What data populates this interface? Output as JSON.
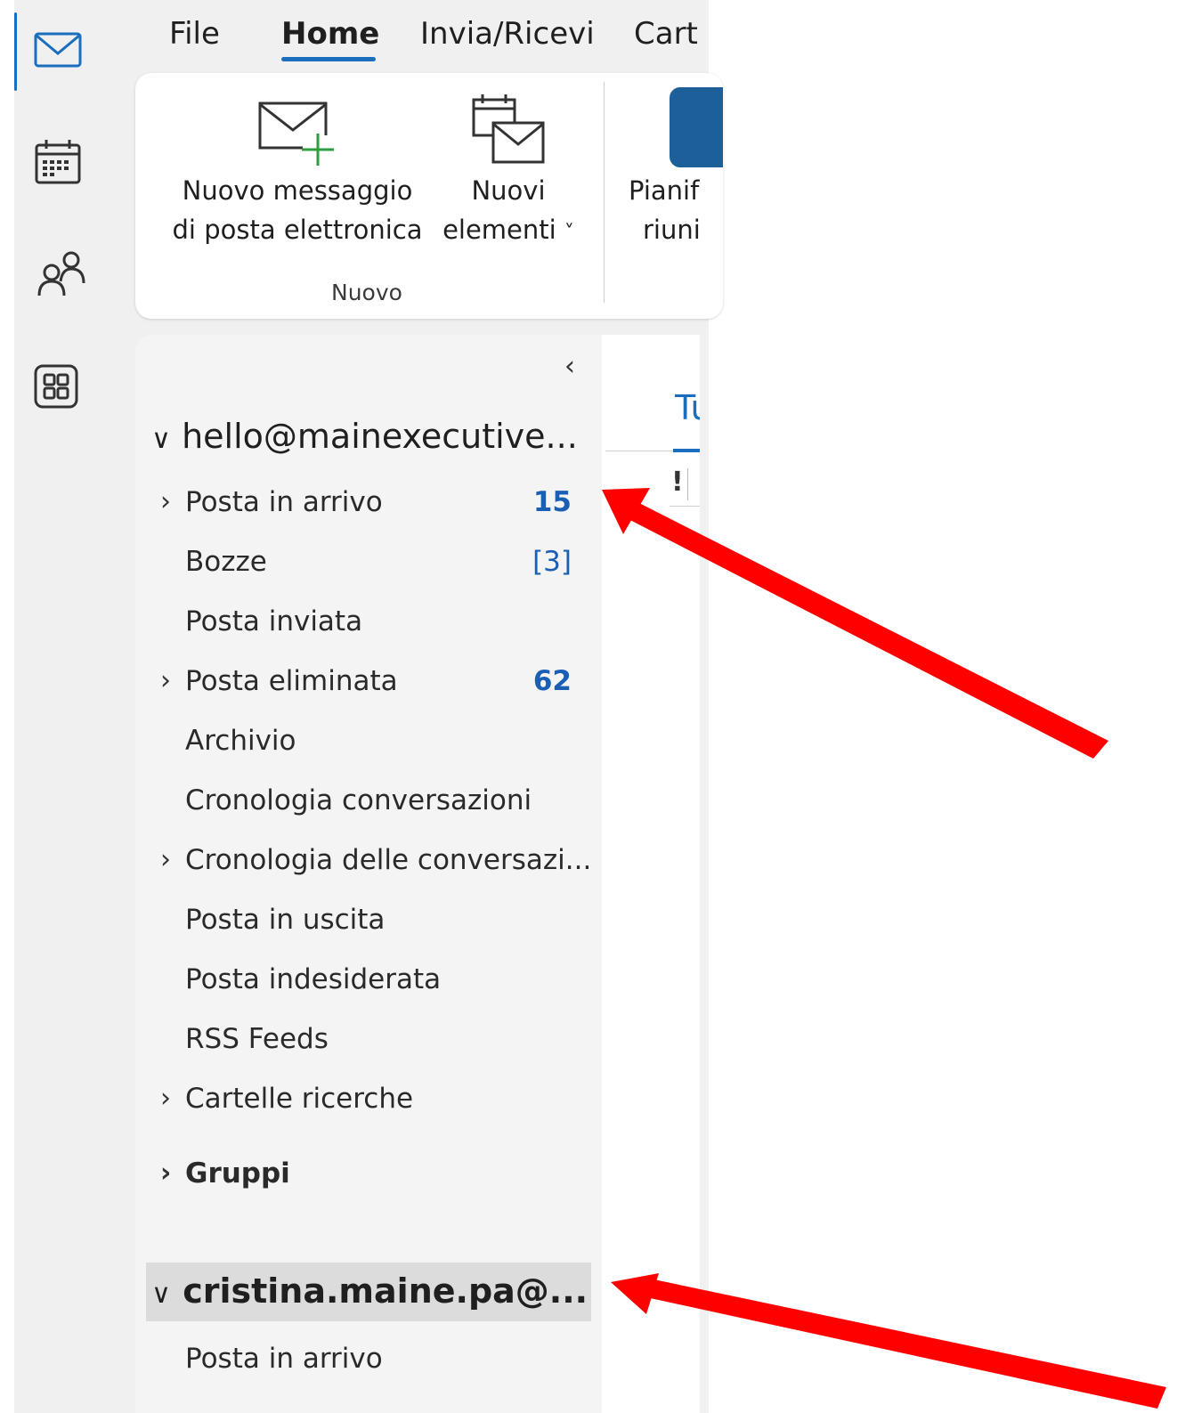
{
  "nav": {
    "items": [
      {
        "icon": "mail-icon",
        "active": true
      },
      {
        "icon": "calendar-icon",
        "active": false
      },
      {
        "icon": "people-icon",
        "active": false
      },
      {
        "icon": "apps-icon",
        "active": false
      }
    ]
  },
  "tabs": [
    {
      "label": "File"
    },
    {
      "label": "Home",
      "active": true
    },
    {
      "label": "Invia/Ricevi"
    },
    {
      "label": "Cart"
    }
  ],
  "ribbon": {
    "new_mail_line1": "Nuovo messaggio",
    "new_mail_line2": "di posta elettronica",
    "new_items_line1": "Nuovi",
    "new_items_line2": "elementi",
    "new_items_chevron": "˅",
    "group_label": "Nuovo",
    "meeting_line1": "Pianif",
    "meeting_line2": "riuni"
  },
  "folder_pane": {
    "collapse_glyph": "‹",
    "account1": {
      "chevron": "∨",
      "name": "hello@mainexecutive...",
      "folders": [
        {
          "label": "Posta in arrivo",
          "count": "15",
          "expandable": true,
          "count_style": "bold"
        },
        {
          "label": "Bozze",
          "count": "[3]",
          "expandable": false,
          "count_style": "normal"
        },
        {
          "label": "Posta inviata",
          "count": "",
          "expandable": false
        },
        {
          "label": "Posta eliminata",
          "count": "62",
          "expandable": true,
          "count_style": "bold"
        },
        {
          "label": "Archivio",
          "count": "",
          "expandable": false
        },
        {
          "label": "Cronologia conversazioni",
          "count": "",
          "expandable": false
        },
        {
          "label": "Cronologia delle conversazi...",
          "count": "",
          "expandable": true
        },
        {
          "label": "Posta in uscita",
          "count": "",
          "expandable": false
        },
        {
          "label": "Posta indesiderata",
          "count": "",
          "expandable": false
        },
        {
          "label": "RSS Feeds",
          "count": "",
          "expandable": false
        },
        {
          "label": "Cartelle ricerche",
          "count": "",
          "expandable": true
        }
      ]
    },
    "groups": {
      "chevron": "›",
      "label": "Gruppi"
    },
    "account2": {
      "chevron": "∨",
      "name": "cristina.maine.pa@...",
      "folders": [
        {
          "label": "Posta in arrivo"
        }
      ]
    }
  },
  "message_list": {
    "tab_partial": "Tu",
    "importance_glyph": "!"
  },
  "colors": {
    "accent": "#1a6ebd",
    "annotation_arrow": "#ff0000"
  }
}
